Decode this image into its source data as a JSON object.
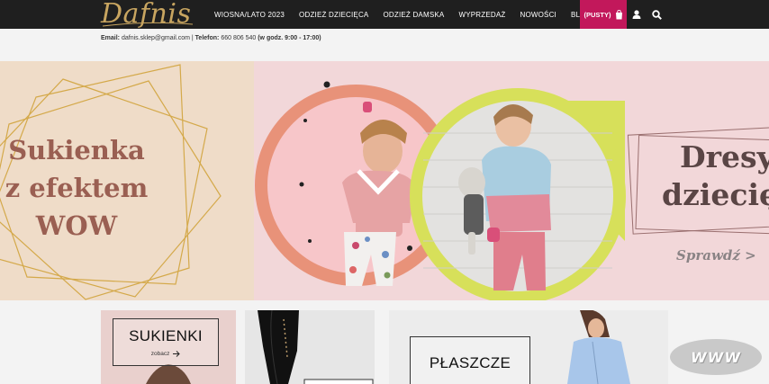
{
  "brand": {
    "logo_text": "Dafnis"
  },
  "nav": {
    "items": [
      {
        "label": "WIOSNA/LATO 2023"
      },
      {
        "label": "ODZIEŻ DZIECIĘCA"
      },
      {
        "label": "ODZIEŻ DAMSKA"
      },
      {
        "label": "WYPRZEDAŻ"
      },
      {
        "label": "NOWOŚCI"
      },
      {
        "label": "BLOG"
      }
    ],
    "cart_label": "(PUSTY)",
    "icons": [
      "cart-icon",
      "user-icon",
      "search-icon"
    ]
  },
  "contact": {
    "email_label": "Email:",
    "email": "dafnis.sklep@gmail.com",
    "separator": "|",
    "phone_label": "Telefon:",
    "phone": "660 806 540",
    "hours": "(w godz. 9:00 - 17:00)"
  },
  "hero": {
    "left_title": [
      "Sukienka",
      "z efektem",
      "WOW"
    ],
    "right_title": [
      "Dresy",
      "dziecięce"
    ],
    "cta": "Sprawdź >"
  },
  "categories": [
    {
      "title": "SUKIENKI",
      "sub": "zobacz"
    },
    {
      "title": "PŁASZCZE",
      "sub": ""
    }
  ],
  "badge": {
    "text": "WWW"
  },
  "colors": {
    "topbar": "#1f1f1f",
    "accent": "#c2185b",
    "logo_gold": "#c8a560",
    "hero_text": "#9a5f52"
  }
}
